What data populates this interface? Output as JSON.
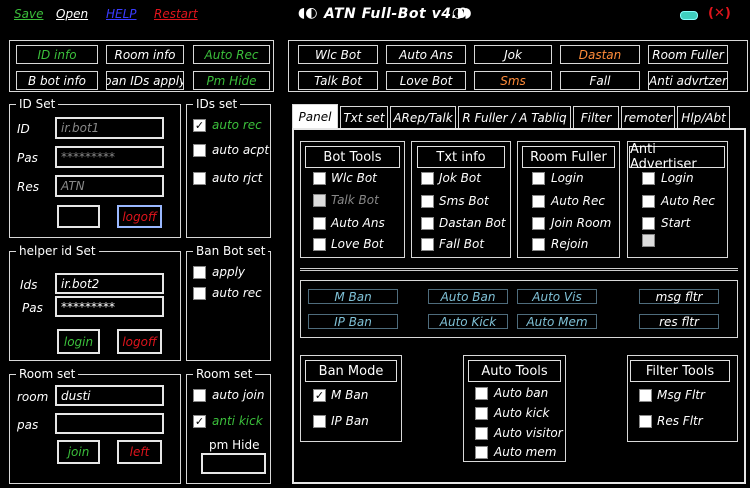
{
  "menu": {
    "save": "Save",
    "open": "Open",
    "help": "HELP",
    "restart": "Restart"
  },
  "app": {
    "title": "ATN Full-Bot v4.0",
    "close_glyph": "(✕)"
  },
  "colors": {
    "green": "#3bbf3b",
    "red": "#e0141c",
    "blue": "#3a3cff",
    "orange": "#ff8c3a",
    "teal": "#7fc1d6"
  },
  "top_buttons": {
    "id_info": "ID info",
    "room_info": "Room info",
    "auto_rec": "Auto Rec",
    "b_bot_info": "B bot info",
    "ban_ids_apply": "ban IDs apply",
    "pm_hide": "Pm Hide"
  },
  "bot_buttons": {
    "wlc_bot": "Wlc Bot",
    "auto_ans": "Auto Ans",
    "jok": "Jok",
    "dastan": "Dastan",
    "room_fuller": "Room Fuller",
    "talk_bot": "Talk Bot",
    "love_bot": "Love Bot",
    "sms": "Sms",
    "fall": "Fall",
    "anti_advrtzer": "Anti advrtzer"
  },
  "id_set": {
    "title": "ID Set",
    "id_label": "ID",
    "pas_label": "Pas",
    "res_label": "Res",
    "id_value": "ir.bot1",
    "pas_value": "*********",
    "res_value": "ATN",
    "logoff": "logoff"
  },
  "ids_set": {
    "title": "IDs set",
    "auto_rec": "auto rec",
    "auto_acpt": "auto acpt",
    "auto_rjct": "auto rjct"
  },
  "helper": {
    "title": "helper id Set",
    "ids_label": "Ids",
    "pas_label": "Pas",
    "ids_value": "ir.bot2",
    "pas_value": "*********",
    "login": "login",
    "logoff": "logoff"
  },
  "ban_bot": {
    "title": "Ban Bot set",
    "apply": "apply",
    "auto_rec": "auto rec"
  },
  "room_set": {
    "title": "Room set",
    "room_label": "room",
    "pas_label": "pas",
    "room_value": "dusti",
    "join": "join",
    "left": "left"
  },
  "room_set2": {
    "title": "Room set",
    "auto_join": "auto join",
    "anti_kick": "anti kick",
    "pm_hide": "pm Hide"
  },
  "tabs": [
    "Panel",
    "Txt set",
    "ARep/Talk",
    "R Fuller / A Tabliq",
    "Filter",
    "remoter",
    "Hlp/Abt"
  ],
  "bot_tools": {
    "title": "Bot Tools",
    "items": [
      "Wlc Bot",
      "Talk Bot",
      "Auto Ans",
      "Love Bot"
    ]
  },
  "txt_info": {
    "title": "Txt info",
    "items": [
      "Jok Bot",
      "Sms Bot",
      "Dastan Bot",
      "Fall Bot"
    ]
  },
  "room_fuller": {
    "title": "Room Fuller",
    "items": [
      "Login",
      "Auto Rec",
      "Join Room",
      "Rejoin"
    ]
  },
  "anti_adv": {
    "title": "Anti Advertiser",
    "items": [
      "Login",
      "Auto Rec",
      "Start"
    ]
  },
  "ban_buttons": {
    "m_ban": "M Ban",
    "auto_ban": "Auto Ban",
    "auto_vis": "Auto Vis",
    "msg_fltr": "msg fltr",
    "ip_ban": "IP Ban",
    "auto_kick": "Auto Kick",
    "auto_mem": "Auto Mem",
    "res_fltr": "res fltr"
  },
  "ban_mode": {
    "title": "Ban Mode",
    "items": [
      "M Ban",
      "IP Ban"
    ]
  },
  "auto_tools": {
    "title": "Auto Tools",
    "items": [
      "Auto ban",
      "Auto kick",
      "Auto visitor",
      "Auto mem"
    ]
  },
  "filter_tools": {
    "title": "Filter Tools",
    "items": [
      "Msg Fltr",
      "Res Fltr"
    ]
  }
}
